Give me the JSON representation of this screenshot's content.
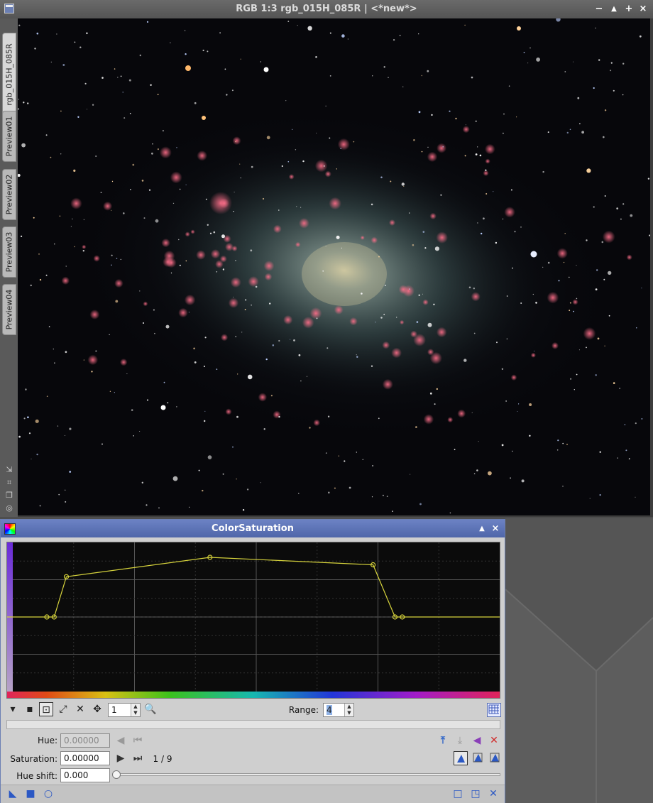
{
  "image_window": {
    "title": "RGB 1:3 rgb_015H_085R | <*new*>",
    "tabs": [
      "rgb_015H_085R",
      "Preview01",
      "Preview02",
      "Preview03",
      "Preview04"
    ],
    "controls": {
      "minimize": "−",
      "shade": "▲",
      "maximize": "+",
      "close": "×"
    },
    "side_icons": [
      "resize-icon",
      "crop-icon",
      "copy-icon",
      "target-icon"
    ]
  },
  "dialog": {
    "title": "ColorSaturation",
    "toolbar": {
      "zoom_value": "1",
      "range_label": "Range:",
      "range_value": "4"
    },
    "labels": {
      "hue": "Hue:",
      "saturation": "Saturation:",
      "hue_shift": "Hue shift:"
    },
    "values": {
      "hue": "0.00000",
      "saturation": "0.00000",
      "hue_shift": "0.000",
      "point_index": "1 / 9"
    },
    "curve_points": [
      [
        0.07,
        0.5
      ],
      [
        0.085,
        0.5
      ],
      [
        0.11,
        0.23
      ],
      [
        0.405,
        0.1
      ],
      [
        0.74,
        0.15
      ],
      [
        0.785,
        0.5
      ],
      [
        0.8,
        0.5
      ]
    ],
    "accent_color": "#5a70b4",
    "curve_color": "#d6d33c"
  }
}
